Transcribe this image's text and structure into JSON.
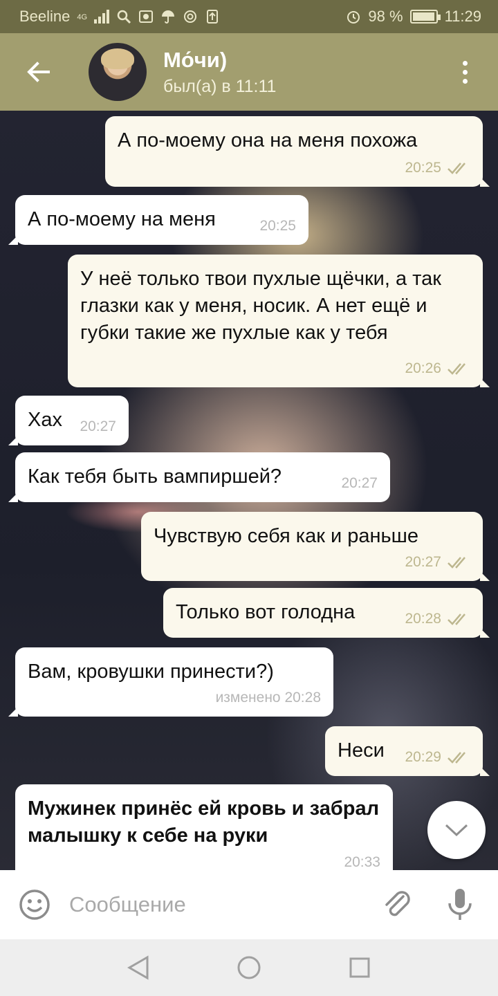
{
  "status_bar": {
    "carrier": "Beeline",
    "network": "4G",
    "battery_text": "98 %",
    "battery_level": 0.98,
    "time": "11:29"
  },
  "header": {
    "title": "Мо́чи)",
    "subtitle": "был(а) в 11:11"
  },
  "messages": [
    {
      "direction": "out",
      "text": "А по-моему она на меня похожа",
      "time": "20:25",
      "read": true
    },
    {
      "direction": "in",
      "text": "А по-моему на меня",
      "time": "20:25"
    },
    {
      "direction": "out",
      "text": "У неё только твои пухлые щёчки, а так глазки как у меня, носик. А нет ещё и губки такие же пухлые как у тебя",
      "time": "20:26",
      "read": true
    },
    {
      "direction": "in",
      "text": "Хах",
      "time": "20:27"
    },
    {
      "direction": "in",
      "text": "Как тебя быть вампиршей?",
      "time": "20:27"
    },
    {
      "direction": "out",
      "text": "Чувствую себя как и раньше",
      "time": "20:27",
      "read": true
    },
    {
      "direction": "out",
      "text": "Только вот голодна",
      "time": "20:28",
      "read": true
    },
    {
      "direction": "in",
      "text": "Вам, кровушки принести?)",
      "time": "изменено 20:28"
    },
    {
      "direction": "out",
      "text": "Неси",
      "time": "20:29",
      "read": true
    },
    {
      "direction": "in",
      "text": "Мужинек принёс ей кровь и забрал малышку к себе на руки",
      "time": "20:33",
      "bold": true
    }
  ],
  "input": {
    "placeholder": "Сообщение"
  },
  "icons": {
    "back": "arrow-left-icon",
    "menu": "more-vert-icon",
    "emoji": "smile-icon",
    "attach": "paperclip-icon",
    "mic": "microphone-icon",
    "scroll": "chevron-down-icon"
  },
  "colors": {
    "header": "#a29e6f",
    "status_bar": "#6d6b45",
    "bubble_out": "#fbf8ec",
    "bubble_in": "#ffffff",
    "tick": "#bdb78f"
  }
}
